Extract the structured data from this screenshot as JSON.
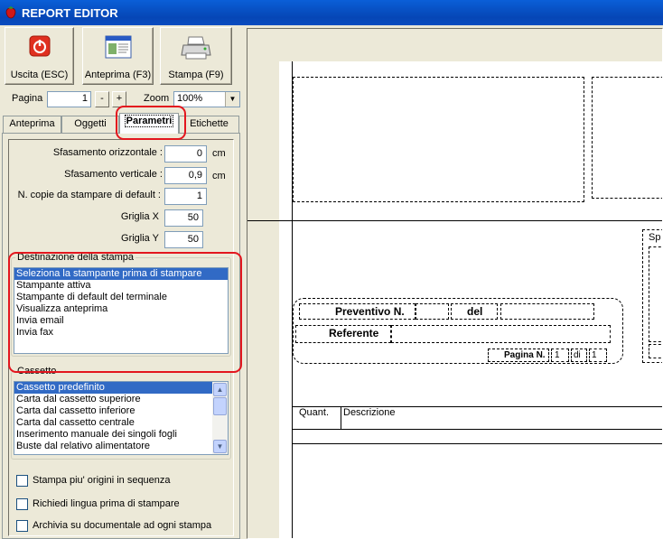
{
  "window": {
    "title": "REPORT EDITOR"
  },
  "toolbar": {
    "exit_label": "Uscita (ESC)",
    "preview_label": "Anteprima (F3)",
    "print_label": "Stampa (F9)"
  },
  "pager": {
    "page_label": "Pagina",
    "page_value": "1",
    "minus": "-",
    "plus": "+",
    "zoom_label": "Zoom",
    "zoom_value": "100%"
  },
  "tabs": [
    "Anteprima",
    "Oggetti",
    "Parametri",
    "Etichette"
  ],
  "params": {
    "h_offset_label": "Sfasamento orizzontale :",
    "h_offset_value": "0",
    "h_offset_unit": "cm",
    "v_offset_label": "Sfasamento verticale :",
    "v_offset_value": "0,9",
    "v_offset_unit": "cm",
    "copies_label": "N. copie da stampare di default :",
    "copies_value": "1",
    "grid_x_label": "Griglia X",
    "grid_x_value": "50",
    "grid_y_label": "Griglia Y",
    "grid_y_value": "50"
  },
  "destination": {
    "title": "Destinazione della stampa",
    "items": [
      "Seleziona la stampante prima di stampare",
      "Stampante attiva",
      "Stampante di default del terminale",
      "Visualizza anteprima",
      "Invia email",
      "Invia fax"
    ],
    "selected_index": 0
  },
  "tray": {
    "title": "Cassetto",
    "items": [
      "Cassetto predefinito",
      "Carta dal cassetto superiore",
      "Carta dal cassetto inferiore",
      "Carta dal cassetto centrale",
      "Inserimento manuale dei singoli fogli",
      "Buste dal relativo alimentatore"
    ],
    "selected_index": 0
  },
  "checkboxes": [
    "Stampa piu' origini in sequenza",
    "Richiedi lingua prima di stampare",
    "Archivia su documentale ad ogni stampa"
  ],
  "report": {
    "preventivo": "Preventivo N.",
    "del": "del",
    "referente": "Referente",
    "pagina": "Pagina N.",
    "page_num": "1",
    "di": "di",
    "page_total": "1",
    "col_quant": "Quant.",
    "col_descr": "Descrizione",
    "sp": "Sp"
  },
  "colors": {
    "highlight": "#e3161e",
    "selection": "#316ac5",
    "titlebar": "#0a5fd8"
  }
}
